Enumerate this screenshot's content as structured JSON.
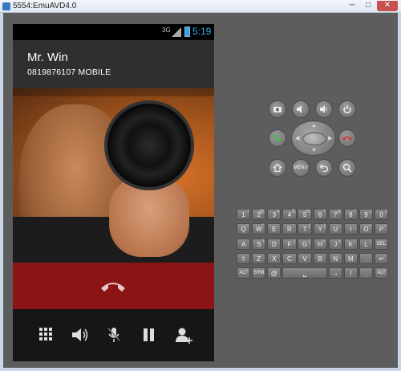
{
  "window": {
    "title": "5554:EmuAVD4.0"
  },
  "statusbar": {
    "network": "3G",
    "time": "5:19"
  },
  "caller": {
    "name": "Mr. Win",
    "number": "0819876107  MOBILE"
  },
  "controls": {
    "icons": [
      "camera-icon",
      "volume-down-icon",
      "volume-up-icon",
      "power-icon",
      "call-icon",
      "end-call-icon",
      "home-icon",
      "back-icon",
      "search-icon"
    ],
    "menu_label": "MENU"
  },
  "keyboard": {
    "rows": [
      [
        [
          "1",
          "!"
        ],
        [
          "2",
          "@"
        ],
        [
          "3",
          "#"
        ],
        [
          "4",
          "$"
        ],
        [
          "5",
          "%"
        ],
        [
          "6",
          "^"
        ],
        [
          "7",
          "&"
        ],
        [
          "8",
          "*"
        ],
        [
          "9",
          "("
        ],
        [
          "0",
          ")"
        ]
      ],
      [
        [
          "Q",
          "~"
        ],
        [
          "W",
          "\""
        ],
        [
          "E",
          ""
        ],
        [
          "R",
          ""
        ],
        [
          "T",
          "{"
        ],
        [
          "Y",
          "}"
        ],
        [
          "U",
          "-"
        ],
        [
          "I",
          "_"
        ],
        [
          "O",
          "+"
        ],
        [
          "P",
          "="
        ]
      ],
      [
        [
          "A",
          ""
        ],
        [
          "S",
          "\\"
        ],
        [
          "D",
          ""
        ],
        [
          "F",
          "["
        ],
        [
          "G",
          "]"
        ],
        [
          "H",
          "<"
        ],
        [
          "J",
          ">"
        ],
        [
          "K",
          ";"
        ],
        [
          "L",
          ":"
        ],
        [
          "DEL",
          ""
        ]
      ],
      [
        [
          "⇧",
          ""
        ],
        [
          "Z",
          ""
        ],
        [
          "X",
          ""
        ],
        [
          "C",
          ""
        ],
        [
          "V",
          ""
        ],
        [
          "B",
          ""
        ],
        [
          "N",
          ""
        ],
        [
          "M",
          ""
        ],
        [
          ".",
          ""
        ],
        [
          "↵",
          ""
        ]
      ],
      [
        [
          "ALT",
          ""
        ],
        [
          "SYM",
          ""
        ],
        [
          "@",
          ""
        ],
        [
          "␣",
          ""
        ],
        [
          "→",
          ""
        ],
        [
          "/",
          ""
        ],
        [
          ",",
          ""
        ],
        [
          "ALT",
          ""
        ]
      ]
    ]
  },
  "colors": {
    "accent": "#33b5e5",
    "end_call": "#8b1414",
    "emulator_bg": "#5d5d5d"
  }
}
